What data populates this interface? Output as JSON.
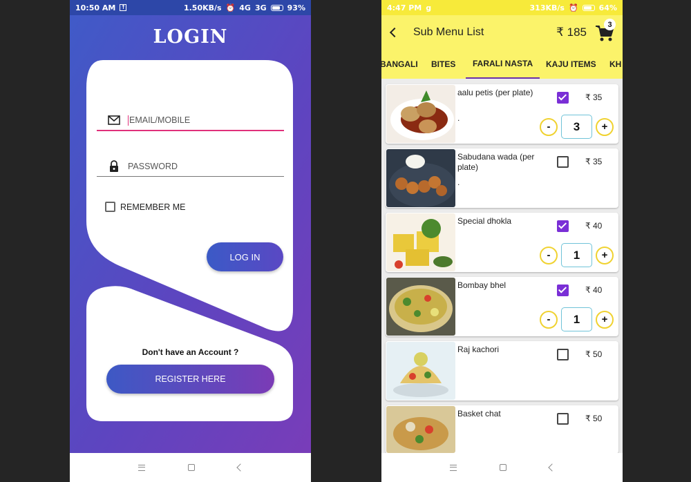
{
  "login_screen": {
    "status": {
      "time": "10:50 AM",
      "speed": "1.50KB/s",
      "net1": "4G",
      "net2": "3G",
      "battery": "93%"
    },
    "title": "LOGIN",
    "email_placeholder": "EMAIL/MOBILE",
    "password_placeholder": "PASSWORD",
    "remember_label": "REMEMBER ME",
    "remember_checked": false,
    "login_button": "LOG IN",
    "no_account_text": "Don't have an Account ?",
    "register_button": "REGISTER HERE",
    "colors": {
      "gradient_start": "#3f5bc8",
      "gradient_end": "#7b3cb8",
      "email_underline": "#e0307a"
    }
  },
  "menu_screen": {
    "status": {
      "time": "4:47 PM",
      "speed": "313KB/s",
      "battery": "64%"
    },
    "title": "Sub Menu List",
    "total": "₹ 185",
    "cart_count": "3",
    "tabs": [
      {
        "label": "BANGALI",
        "active": false
      },
      {
        "label": "BITES",
        "active": false
      },
      {
        "label": "FARALI NASTA",
        "active": true
      },
      {
        "label": "KAJU ITEMS",
        "active": false
      },
      {
        "label": "KH",
        "active": false
      }
    ],
    "items": [
      {
        "name": "aalu petis (per plate)",
        "desc": ".",
        "price": "₹ 35",
        "checked": true,
        "qty": "3",
        "image": "aalu-petis-photo"
      },
      {
        "name": "Sabudana wada (per plate)",
        "desc": ".",
        "price": "₹ 35",
        "checked": false,
        "image": "sabudana-wada-photo"
      },
      {
        "name": "Special dhokla",
        "desc": "",
        "price": "₹ 40",
        "checked": true,
        "qty": "1",
        "image": "dhokla-photo"
      },
      {
        "name": "Bombay bhel",
        "desc": "",
        "price": "₹ 40",
        "checked": true,
        "qty": "1",
        "image": "bhel-photo"
      },
      {
        "name": "Raj kachori",
        "desc": "",
        "price": "₹ 50",
        "checked": false,
        "image": "raj-kachori-photo"
      },
      {
        "name": "Basket chat",
        "desc": "",
        "price": "₹ 50",
        "checked": false,
        "image": "basket-chat-photo"
      }
    ],
    "stepper": {
      "minus": "-",
      "plus": "+"
    },
    "colors": {
      "appbar": "#fbf36a",
      "checkbox": "#7a2fd6",
      "tab_indicator": "#6a2ea8"
    }
  }
}
